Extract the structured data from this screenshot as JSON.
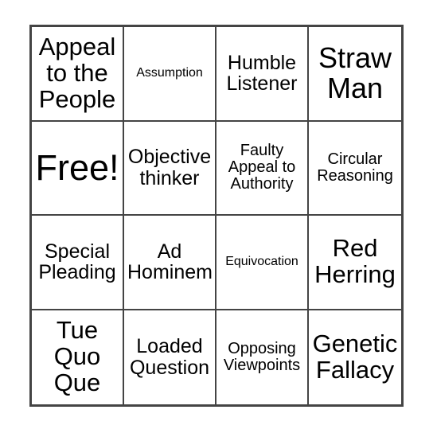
{
  "card": {
    "type": "bingo-card",
    "columns": 4,
    "rows": 4,
    "background_color": "#ffffff",
    "border_color": "#444444",
    "text_color": "#000000",
    "cells": [
      {
        "text": "Appeal\nto the\nPeople",
        "size": "lg"
      },
      {
        "text": "Assumption",
        "size": "xs"
      },
      {
        "text": "Humble\nListener",
        "size": "md"
      },
      {
        "text": "Straw\nMan",
        "size": "xl"
      },
      {
        "text": "Free!",
        "size": "xxl"
      },
      {
        "text": "Objective\nthinker",
        "size": "md"
      },
      {
        "text": "Faulty\nAppeal to\nAuthority",
        "size": "sm"
      },
      {
        "text": "Circular\nReasoning",
        "size": "sm"
      },
      {
        "text": "Special\nPleading",
        "size": "md"
      },
      {
        "text": "Ad\nHominem",
        "size": "md"
      },
      {
        "text": "Equivocation",
        "size": "xs"
      },
      {
        "text": "Red\nHerring",
        "size": "lg"
      },
      {
        "text": "Tue\nQuo\nQue",
        "size": "lg"
      },
      {
        "text": "Loaded\nQuestion",
        "size": "md"
      },
      {
        "text": "Opposing\nViewpoints",
        "size": "sm"
      },
      {
        "text": "Genetic\nFallacy",
        "size": "lg"
      }
    ]
  }
}
